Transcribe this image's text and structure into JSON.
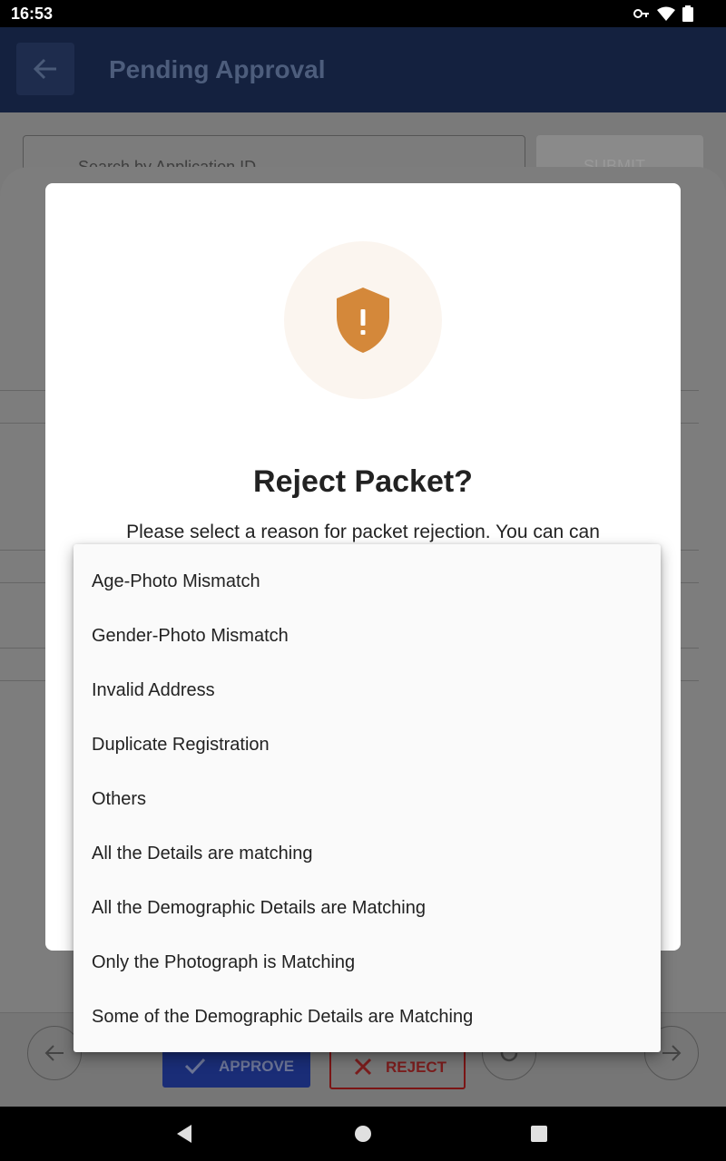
{
  "status_bar": {
    "time": "16:53",
    "icons": [
      "vpn-key-icon",
      "wifi-icon",
      "battery-icon"
    ]
  },
  "app_bar": {
    "title": "Pending Approval"
  },
  "search": {
    "placeholder": "Search by Application ID",
    "submit_label": "SUBMIT"
  },
  "bottom_actions": {
    "approve_label": "APPROVE",
    "reject_label": "REJECT"
  },
  "dialog": {
    "icon": "shield-alert-icon",
    "title": "Reject Packet?",
    "message": "Please select a reason for packet rejection. You can can",
    "icon_color": "#d4883a",
    "icon_bg": "#fbf5ef"
  },
  "reasons": [
    "Age-Photo Mismatch",
    "Gender-Photo Mismatch",
    "Invalid Address",
    "Duplicate Registration",
    "Others",
    "All the Details are matching",
    "All the Demographic Details are Matching",
    "Only the Photograph is Matching",
    "Some of the Demographic Details are Matching"
  ],
  "colors": {
    "app_bar": "#14213f",
    "approve": "#1a2d77",
    "reject": "#b71c1c"
  }
}
